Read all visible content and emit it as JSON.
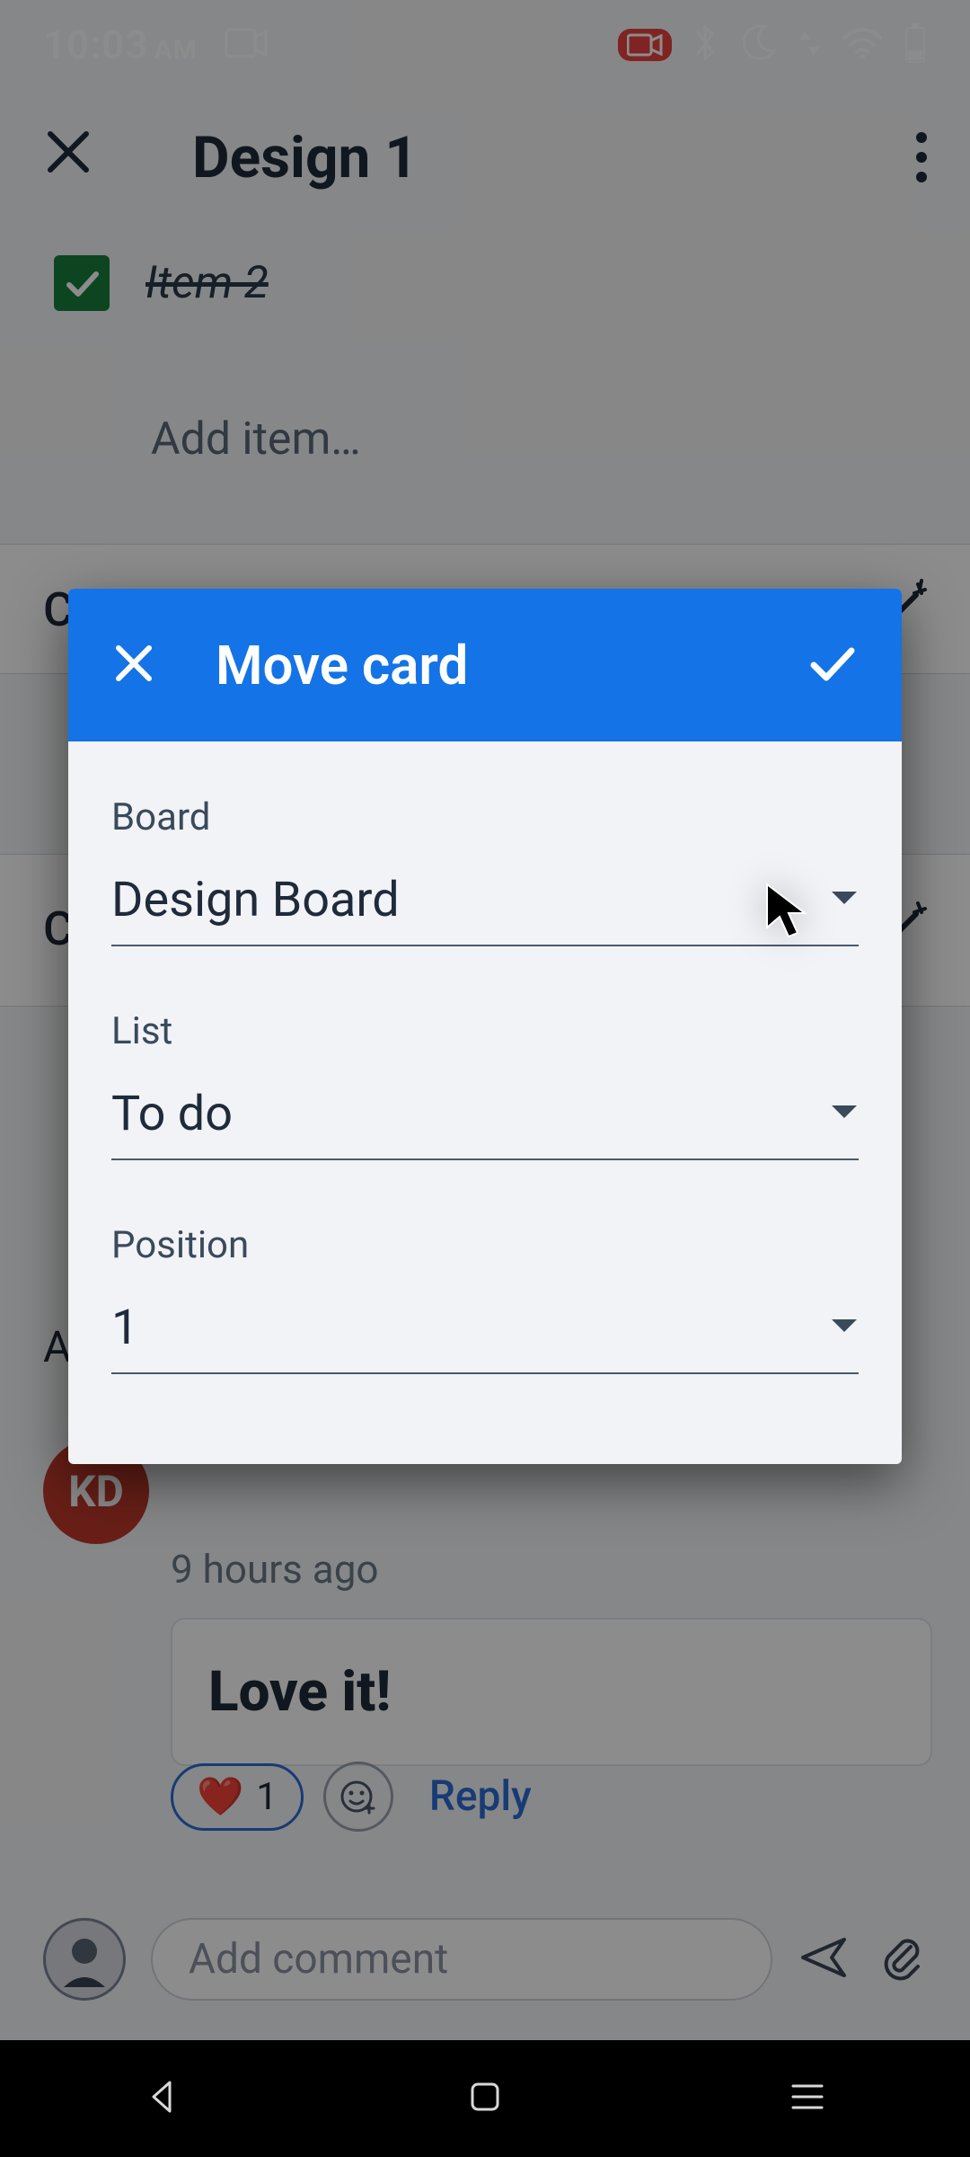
{
  "status": {
    "time": "10:03",
    "ampm": "AM"
  },
  "header": {
    "title": "Design 1"
  },
  "checklist": {
    "item_label": "Item 2",
    "add_placeholder": "Add item…"
  },
  "bg": {
    "row1_letter": "C",
    "row3_letter": "C",
    "activity_letter": "A"
  },
  "activity": {
    "avatar_initials": "KD",
    "timestamp": "9 hours ago",
    "comment_text": "Love it!",
    "reaction_count": "1",
    "reply_label": "Reply"
  },
  "comment_input": {
    "placeholder": "Add comment"
  },
  "dialog": {
    "title": "Move card",
    "board_label": "Board",
    "board_value": "Design Board",
    "list_label": "List",
    "list_value": "To do",
    "position_label": "Position",
    "position_value": "1"
  }
}
